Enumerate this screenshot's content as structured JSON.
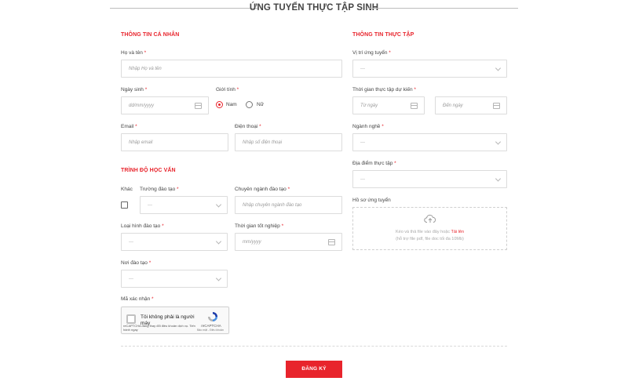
{
  "form": {
    "title": "ỨNG TUYỂN THỰC TẬP SINH",
    "submit_label": "ĐĂNG KÝ"
  },
  "personal": {
    "section_title": "THÔNG TIN CÁ NHÂN",
    "fullname": {
      "label": "Họ và tên",
      "placeholder": "Nhập Họ và tên"
    },
    "birthdate": {
      "label": "Ngày sinh",
      "placeholder": "dd/mm/yyyy"
    },
    "gender": {
      "label": "Giới tính",
      "options": [
        "Nam",
        "Nữ"
      ],
      "selected": "Nam"
    },
    "email": {
      "label": "Email",
      "placeholder": "Nhập email"
    },
    "phone": {
      "label": "Điện thoại",
      "placeholder": "Nhập số điện thoại"
    }
  },
  "education": {
    "section_title": "TRÌNH ĐỘ HỌC VẤN",
    "other_label": "Khác",
    "school": {
      "label": "Trường đào tạo",
      "value": "---"
    },
    "major": {
      "label": "Chuyên ngành đào tạo",
      "placeholder": "Nhập chuyên ngành đào tạo"
    },
    "training_type": {
      "label": "Loại hình đào tạo",
      "value": "---"
    },
    "graduation": {
      "label": "Thời gian tốt nghiệp",
      "placeholder": "mm/yyyy"
    },
    "place": {
      "label": "Nơi đào tạo",
      "value": "---"
    }
  },
  "captcha": {
    "label": "Mã xác nhận",
    "checkbox_text": "Tôi không phải là người máy",
    "brand": "reCAPTCHA",
    "terms": "Bảo mật - Điều khoản",
    "notice": "reCAPTCHA đang thay đổi điều khoản dịch vụ. Tiến hành ngay"
  },
  "internship": {
    "section_title": "THÔNG TIN THỰC TẬP",
    "position": {
      "label": "Vị trí ứng tuyển",
      "value": "---"
    },
    "duration": {
      "label": "Thời gian thực tập dự kiến",
      "from_placeholder": "Từ ngày",
      "to_placeholder": "Đến ngày"
    },
    "field": {
      "label": "Ngành nghề",
      "value": "---"
    },
    "location": {
      "label": "Địa điểm thực tập",
      "value": "---"
    },
    "cv": {
      "label": "Hồ sơ ứng tuyển",
      "drop_text": "Kéo và thả file vào đây hoặc",
      "link_text": "Tải lên",
      "hint": "(hỗ trợ file pdf, file doc tối đa 10Mb)"
    }
  },
  "colors": {
    "accent": "#e8242c",
    "border": "#dcdcdc",
    "text": "#444444"
  },
  "icons": [
    "calendar-icon",
    "chevron-down-icon",
    "upload-cloud-icon",
    "recaptcha-logo-icon"
  ]
}
